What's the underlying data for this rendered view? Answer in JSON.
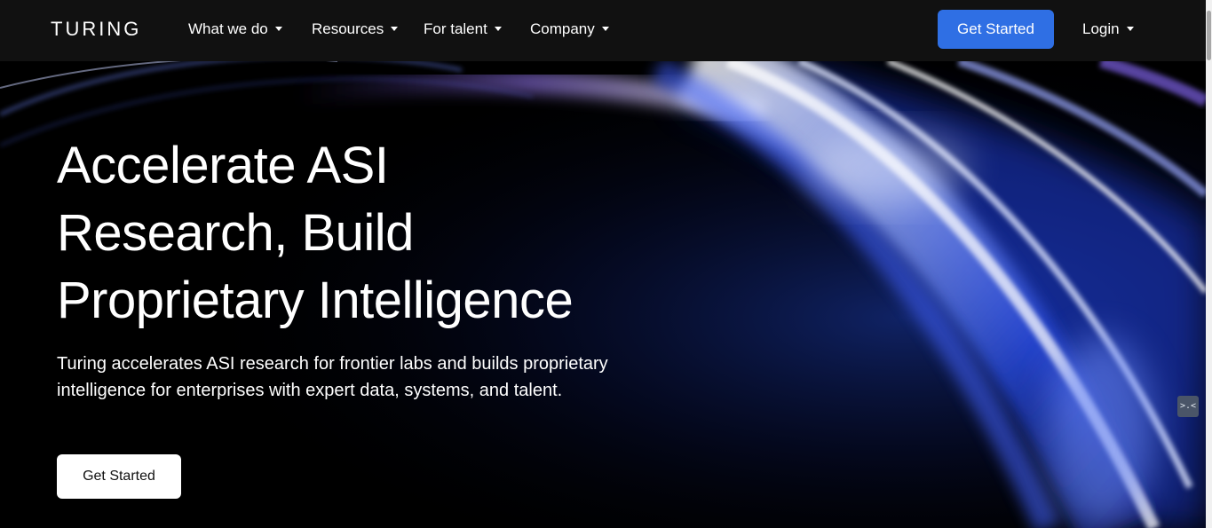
{
  "nav": {
    "logo_text": "TURING",
    "items": [
      {
        "label": "What we do"
      },
      {
        "label": "Resources"
      },
      {
        "label": "For talent"
      },
      {
        "label": "Company"
      }
    ],
    "cta_label": "Get Started",
    "login_label": "Login"
  },
  "hero": {
    "title": "Accelerate ASI\nResearch, Build\nProprietary Intelligence",
    "subtitle": "Turing accelerates ASI research for frontier labs and builds proprietary intelligence for enterprises with expert data, systems, and talent.",
    "cta_label": "Get Started"
  },
  "widget": {
    "glyph": ">.<"
  },
  "colors": {
    "nav_bg": "#111111",
    "accent_blue": "#2f6fe4",
    "hero_bg": "#000000",
    "text_primary": "#ffffff"
  },
  "icons": {
    "nav_caret": "chevron-down-icon",
    "logo": "turing-logo"
  }
}
